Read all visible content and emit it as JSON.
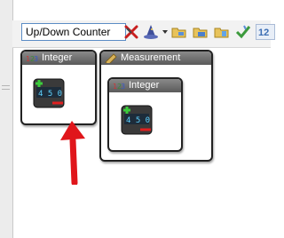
{
  "toolbar": {
    "name_input_value": "Up/Down Counter",
    "text_button_label": "12"
  },
  "blocks": [
    {
      "title": "Integer"
    },
    {
      "title": "Measurement"
    },
    {
      "title": "Integer"
    }
  ],
  "colors": {
    "block_header": "#6e6e6e",
    "block_border": "#222222",
    "annotation_arrow": "#e0161b",
    "input_border": "#5b8cc5"
  },
  "icons": {
    "toolbar": [
      "delete-icon",
      "wizard-icon",
      "folder-open-icon",
      "folder-link-icon",
      "folder-tree-icon",
      "checkmark-icon",
      "numeric-icon"
    ],
    "block": "up-down-counter-icon"
  }
}
